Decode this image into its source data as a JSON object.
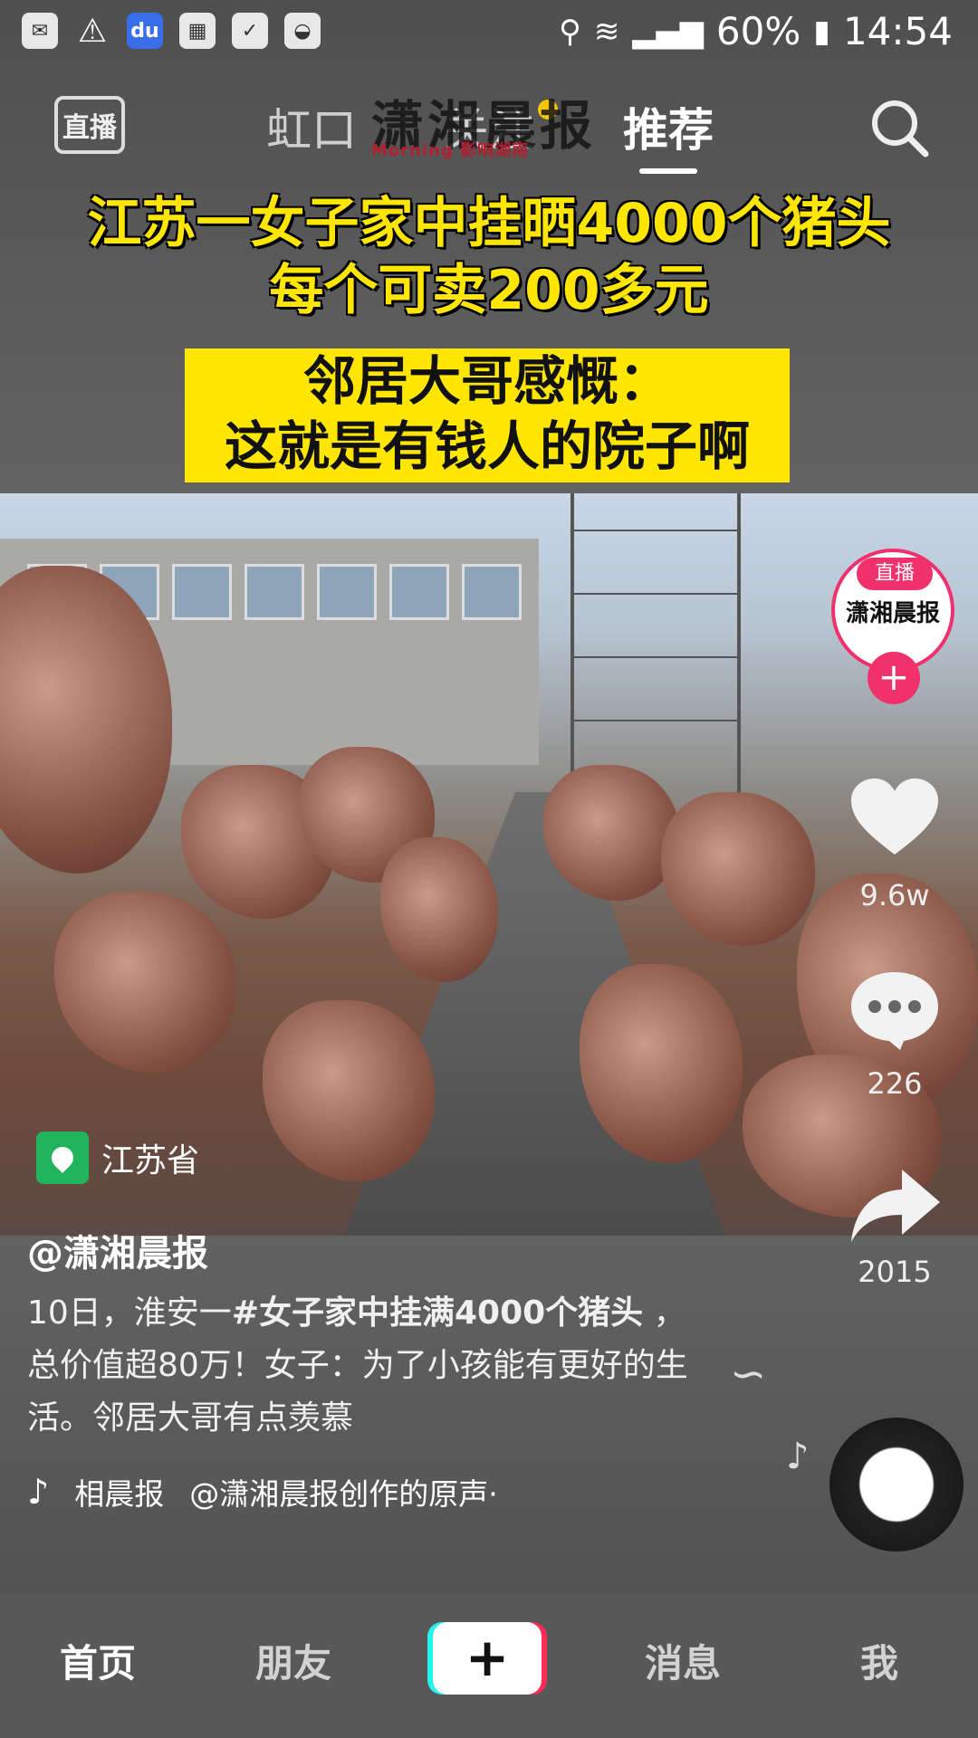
{
  "status_bar": {
    "battery": "60%",
    "time": "14:54",
    "left_icons": [
      "wechat-icon",
      "warning-icon",
      "baidu-icon",
      "calendar-icon",
      "chat-icon",
      "bowl-icon"
    ]
  },
  "top_nav": {
    "live_label": "直播",
    "tabs": [
      {
        "label": "虹口"
      },
      {
        "label": "关注"
      },
      {
        "label": "推荐"
      }
    ],
    "logo_text": "潇湘晨报",
    "logo_sub": "Morning 影响湖南"
  },
  "headline": {
    "line1": "江苏一女子家中挂晒4000个猪头",
    "line2": "每个可卖200多元"
  },
  "subtitle_box": {
    "line1": "邻居大哥感慨：",
    "line2": "这就是有钱人的院子啊"
  },
  "right_rail": {
    "avatar_live": "直播",
    "avatar_text": "潇湘晨报",
    "follow": "+",
    "likes": "9.6w",
    "comments": "226",
    "shares": "2015"
  },
  "location": {
    "label": "江苏省"
  },
  "post": {
    "author": "@潇湘晨报",
    "caption_pre": "10日，淮安一",
    "caption_tag": "#女子家中挂满4000个猪头",
    "caption_post": " ，总价值超80万！女子：为了小孩能有更好的生活。邻居大哥有点羡慕",
    "music_author": "相晨报",
    "music_title": "@潇湘晨报创作的原声·"
  },
  "bottom_nav": {
    "home": "首页",
    "friends": "朋友",
    "plus": "+",
    "messages": "消息",
    "me": "我"
  }
}
